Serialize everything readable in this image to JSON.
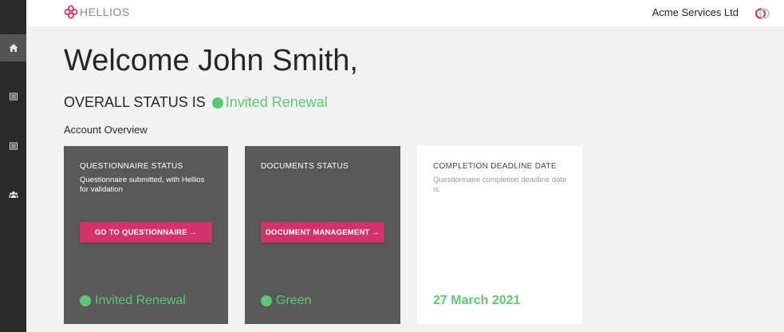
{
  "brand": {
    "name": "HELLIOS"
  },
  "header": {
    "company": "Acme Services Ltd"
  },
  "sidebar": {
    "items": [
      {
        "icon": "home-icon"
      },
      {
        "icon": "list-icon"
      },
      {
        "icon": "list-icon"
      },
      {
        "icon": "users-icon"
      }
    ]
  },
  "main": {
    "welcome": "Welcome John Smith,",
    "overall_prefix": "OVERALL STATUS IS",
    "overall_status": "Invited Renewal",
    "overview_label": "Account Overview"
  },
  "cards": {
    "questionnaire": {
      "title": "QUESTIONNAIRE STATUS",
      "desc": "Questionnaire submitted, with Hellios for validation",
      "button": "GO TO QUESTIONNAIRE →",
      "status": "Invited Renewal"
    },
    "documents": {
      "title": "DOCUMENTS STATUS",
      "button": "DOCUMENT MANAGEMENT →",
      "status": "Green"
    },
    "deadline": {
      "title": "COMPLETION DEADLINE DATE",
      "desc": "Questionnaire completion deadline date is:",
      "date": "27 March 2021"
    }
  },
  "colors": {
    "accent": "#d3326a",
    "status_green": "#5cc872",
    "sidebar": "#2b2b2b",
    "card_dark": "#595959"
  }
}
